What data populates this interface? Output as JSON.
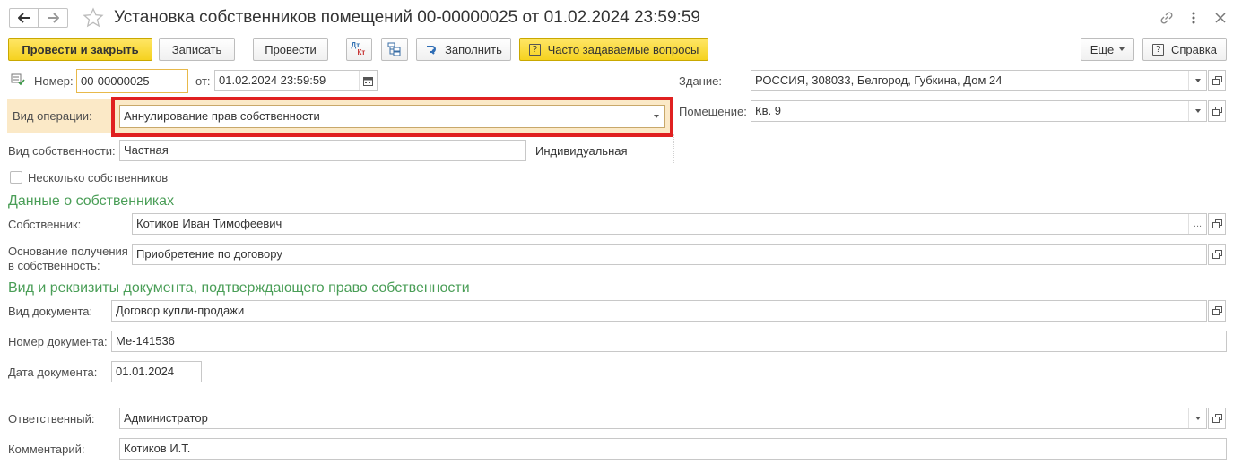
{
  "window": {
    "title": "Установка собственников помещений 00-00000025 от 01.02.2024 23:59:59",
    "icons": [
      "back-arrow-icon",
      "forward-arrow-icon",
      "star-icon",
      "link-icon",
      "more-vertical-icon",
      "close-icon"
    ]
  },
  "toolbar": {
    "post_and_close": "Провести и закрыть",
    "write": "Записать",
    "post": "Провести",
    "dt_kt_top": "Дт",
    "dt_kt_bottom": "Кт",
    "fill": "Заполнить",
    "faq_icon": "?",
    "faq": "Часто задаваемые вопросы",
    "more": "Еще",
    "help_icon": "?",
    "help": "Справка"
  },
  "header": {
    "number_label": "Номер:",
    "number_value": "00-00000025",
    "date_label": "от:",
    "date_value": "01.02.2024 23:59:59",
    "building_label": "Здание:",
    "building_value": "РОССИЯ, 308033, Белгород, Губкина, Дом 24",
    "operation_label": "Вид операции:",
    "operation_value": "Аннулирование прав собственности",
    "room_label": "Помещение:",
    "room_value": "Кв. 9",
    "ownership_label": "Вид собственности:",
    "ownership_value": "Частная",
    "ownership_kind": "Индивидуальная",
    "several_owners_label": "Несколько собственников"
  },
  "owners_section": {
    "title": "Данные о собственниках",
    "owner_label": "Собственник:",
    "owner_value": "Котиков Иван Тимофеевич",
    "owner_select": "...",
    "basis_label_1": "Основание получения",
    "basis_label_2": "в собственность:",
    "basis_value": "Приобретение по договору"
  },
  "document_section": {
    "title": "Вид и реквизиты документа, подтверждающего право собственности",
    "doc_type_label": "Вид документа:",
    "doc_type_value": "Договор купли-продажи",
    "doc_number_label": "Номер документа:",
    "doc_number_value": "Ме-141536",
    "doc_date_label": "Дата документа:",
    "doc_date_value": "01.01.2024"
  },
  "footer": {
    "responsible_label": "Ответственный:",
    "responsible_value": "Администратор",
    "comment_label": "Комментарий:",
    "comment_value": "Котиков И.Т."
  },
  "colors": {
    "accent_yellow": "#f5d21f",
    "section_green": "#4a9e57",
    "highlight_red": "#e02020",
    "operation_row_bg": "#fbe9c7"
  }
}
